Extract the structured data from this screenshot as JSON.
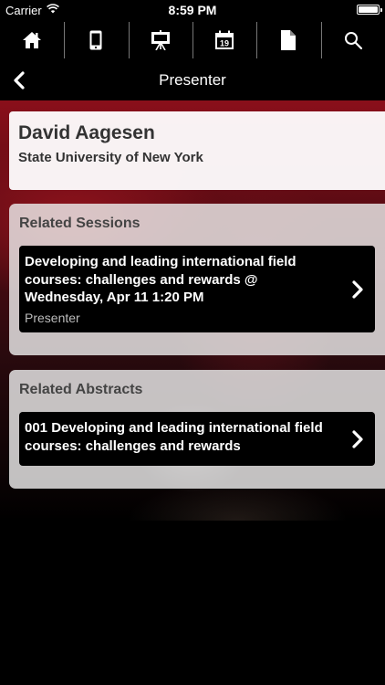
{
  "status_bar": {
    "carrier": "Carrier",
    "time": "8:59 PM"
  },
  "toolbar": {
    "icons": [
      "home-icon",
      "mobile-device-icon",
      "presentation-easel-icon",
      "calendar-icon",
      "document-icon",
      "search-icon"
    ],
    "calendar_day": "19"
  },
  "nav": {
    "title": "Presenter"
  },
  "presenter": {
    "name": "David Aagesen",
    "organization": "State University of New York"
  },
  "related_sessions": {
    "title": "Related Sessions",
    "items": [
      {
        "title": "Developing and leading international field courses: challenges and rewards @ Wednesday, Apr 11 1:20 PM",
        "role": "Presenter"
      }
    ]
  },
  "related_abstracts": {
    "title": "Related Abstracts",
    "items": [
      {
        "title": "001 Developing and leading international field courses: challenges and rewards"
      }
    ]
  },
  "colors": {
    "accent": "#8a0f1a",
    "background": "#000000"
  }
}
